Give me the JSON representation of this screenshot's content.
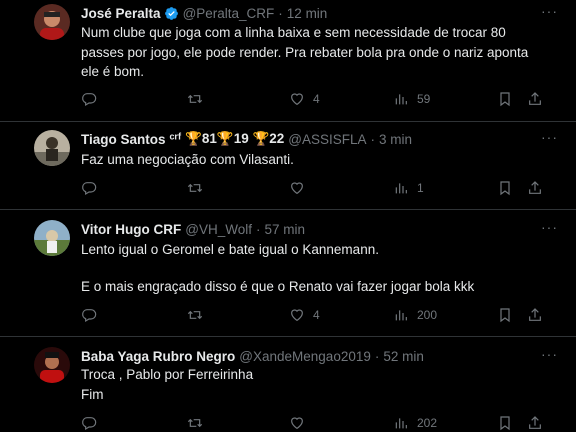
{
  "tweets": [
    {
      "name": "José Peralta",
      "verified": true,
      "handle": "@Peralta_CRF",
      "time": "12 min",
      "lines": [
        "Num clube que joga com a linha baixa e sem necessidade de trocar 80",
        "passes por jogo, ele pode render. Pra rebater bola pra onde o nariz aponta",
        "ele é bom."
      ],
      "likes": "4",
      "views": "59"
    },
    {
      "name": "Tiago Santos",
      "trophies": "ᶜʳᶠ 🏆81🏆19 🏆22",
      "handle": "@ASSISFLA",
      "time": "3 min",
      "lines": [
        "Faz uma negociação com Vilasanti."
      ],
      "likes": "",
      "views": "1"
    },
    {
      "name": "Vitor Hugo CRF",
      "handle": "@VH_Wolf",
      "time": "57 min",
      "lines": [
        "Lento igual o Geromel e bate igual o Kannemann.",
        "E o mais engraçado disso é que o Renato vai fazer jogar bola kkk"
      ],
      "likes": "4",
      "views": "200"
    },
    {
      "name": "Baba Yaga Rubro Negro",
      "handle": "@XandeMengao2019",
      "time": "52 min",
      "lines": [
        "Troca , Pablo por Ferreirinha",
        "Fim"
      ],
      "likes": "",
      "views": "202"
    }
  ],
  "separator": "·",
  "more_label": "···",
  "icons": [
    "more-icon",
    "reply-icon",
    "retweet-icon",
    "like-icon",
    "views-icon",
    "bookmark-icon",
    "share-icon",
    "verified-badge-icon"
  ],
  "colors": {
    "background": "#000000",
    "text": "#e7e9ea",
    "muted": "#71767b",
    "verified": "#1d9bf0",
    "divider": "#2f3336"
  }
}
